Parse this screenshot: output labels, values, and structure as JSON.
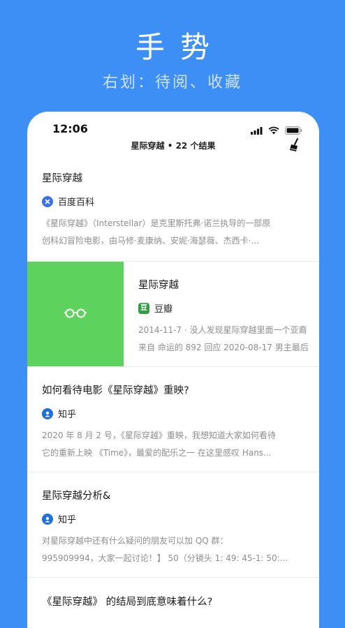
{
  "promo": {
    "title": "手势",
    "subtitle": "右划：待阅、收藏"
  },
  "status_bar": {
    "time": "12:06",
    "icons": [
      "signal-icon",
      "wifi-icon",
      "battery-icon"
    ]
  },
  "navbar": {
    "title": "星际穿越 • 22 个结果",
    "action_icon": "broom-clean-icon"
  },
  "results": [
    {
      "title": "星际穿越",
      "source": "百度百科",
      "source_icon": "baidu-icon",
      "snippet_1": "《星际穿越》（Interstellar）是克里斯托弗·诺兰执导的一部原",
      "snippet_2": "创科幻冒险电影，由马修·麦康纳、安妮·海瑟薇、杰西卡·..."
    },
    {
      "title": "星际穿越",
      "source": "豆瓣",
      "source_icon": "douban-icon",
      "snippet_1": "2014-11-7 · 没人发现星际穿越里面一个亚裔",
      "snippet_2": "来自 命运的 892 回应 2020-08-17 男主最后",
      "swipe_action_icon": "glasses-read-later-icon"
    },
    {
      "title": "如何看待电影《星际穿越》重映?",
      "source": "知乎",
      "source_icon": "zhihu-icon",
      "snippet_1": "2020 年 8 月 2 号，《星际穿越》重映，我想知道大家如何看待",
      "snippet_2": "它的重新上映 《Time》，最爱的配乐之一 在这里感叹 Hans..."
    },
    {
      "title": "星际穿越分析&",
      "source": "知乎",
      "source_icon": "zhihu-icon",
      "snippet_1": "对星际穿越中还有什么疑问的朋友可以加 QQ 群：",
      "snippet_2": "995909994，大家一起讨论！】 50（分镜头 1: 49: 45-1: 50:..."
    },
    {
      "title": "《星际穿越》 的结局到底意味着什么?"
    }
  ],
  "colors": {
    "background": "#3d8ff5",
    "swipe_action": "#5dd35d",
    "baidu": "#3a6ff0",
    "douban": "#2f9e45",
    "zhihu": "#1f6fdc"
  }
}
